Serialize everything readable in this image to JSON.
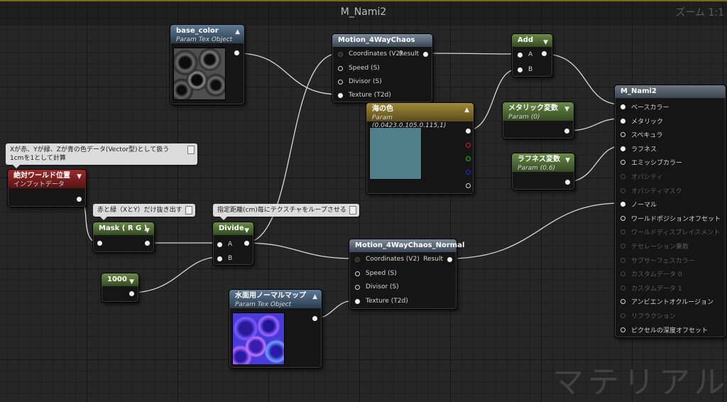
{
  "graph": {
    "title": "M_Nami2",
    "zoom": "ズーム 1:1",
    "watermark": "マテリアル"
  },
  "base_color": {
    "title": "base_color",
    "subtitle": "Param Tex Object"
  },
  "motion1": {
    "title": "Motion_4WayChaos",
    "in": [
      "Coordinates (V2)",
      "Speed (S)",
      "Divisor (S)",
      "Texture (T2d)"
    ],
    "out": "Result"
  },
  "add": {
    "title": "Add",
    "in": [
      "A",
      "B"
    ]
  },
  "umi_no_iro": {
    "title": "海の色",
    "subtitle": "Param (0.0423,0.105,0.115,1)",
    "color": "#4f7f88"
  },
  "metallic_param": {
    "title": "メタリック変数",
    "subtitle": "Param (0)"
  },
  "roughness_param": {
    "title": "ラフネス変数",
    "subtitle": "Param (0.6)"
  },
  "m_nami2": {
    "title": "M_Nami2",
    "pins": [
      {
        "label": "ベースカラー",
        "active": true
      },
      {
        "label": "メタリック",
        "active": true
      },
      {
        "label": "スペキュラ",
        "active": true
      },
      {
        "label": "ラフネス",
        "active": true
      },
      {
        "label": "エミッシブカラー",
        "active": true
      },
      {
        "label": "オパシティ",
        "active": false
      },
      {
        "label": "オパシティマスク",
        "active": false
      },
      {
        "label": "ノーマル",
        "active": true
      },
      {
        "label": "ワールドポジションオフセット",
        "active": true
      },
      {
        "label": "ワールドディスプレイスメント",
        "active": false
      },
      {
        "label": "テセレーション乗数",
        "active": false
      },
      {
        "label": "サブサーフェスカラー",
        "active": false
      },
      {
        "label": "カスタムデータ 0",
        "active": false
      },
      {
        "label": "カスタムデータ 1",
        "active": false
      },
      {
        "label": "アンビエントオクルージョン",
        "active": true
      },
      {
        "label": "リフラクション",
        "active": false
      },
      {
        "label": "ピクセルの深度オフセット",
        "active": true
      }
    ]
  },
  "comment_world": {
    "text1": "Xが赤、Yが緑、Zが青の色データ(Vector型)として扱う",
    "text2": "1cmを1として計算"
  },
  "world_pos": {
    "title": "絶対ワールド位置",
    "subtitle": "インプットデータ"
  },
  "comment_mask": {
    "text": "赤と緑（XとY）だけ抜き出す"
  },
  "mask": {
    "title": "Mask ( R G )"
  },
  "comment_divide": {
    "text": "指定距離(cm)毎にテクスチャをループさせる"
  },
  "divide": {
    "title": "Divide",
    "in": [
      "A",
      "B"
    ]
  },
  "const1000": {
    "title": "1000"
  },
  "motion2": {
    "title": "Motion_4WayChaos_Normal",
    "in": [
      "Coordinates (V2)",
      "Speed (S)",
      "Divisor (S)",
      "Texture (T2d)"
    ],
    "out": "Result"
  },
  "normal_map": {
    "title": "水面用ノーマルマップ",
    "subtitle": "Param Tex Object"
  },
  "colors": {
    "pin_red": "#d02020",
    "pin_green": "#20c020",
    "pin_blue": "#2030d0"
  }
}
